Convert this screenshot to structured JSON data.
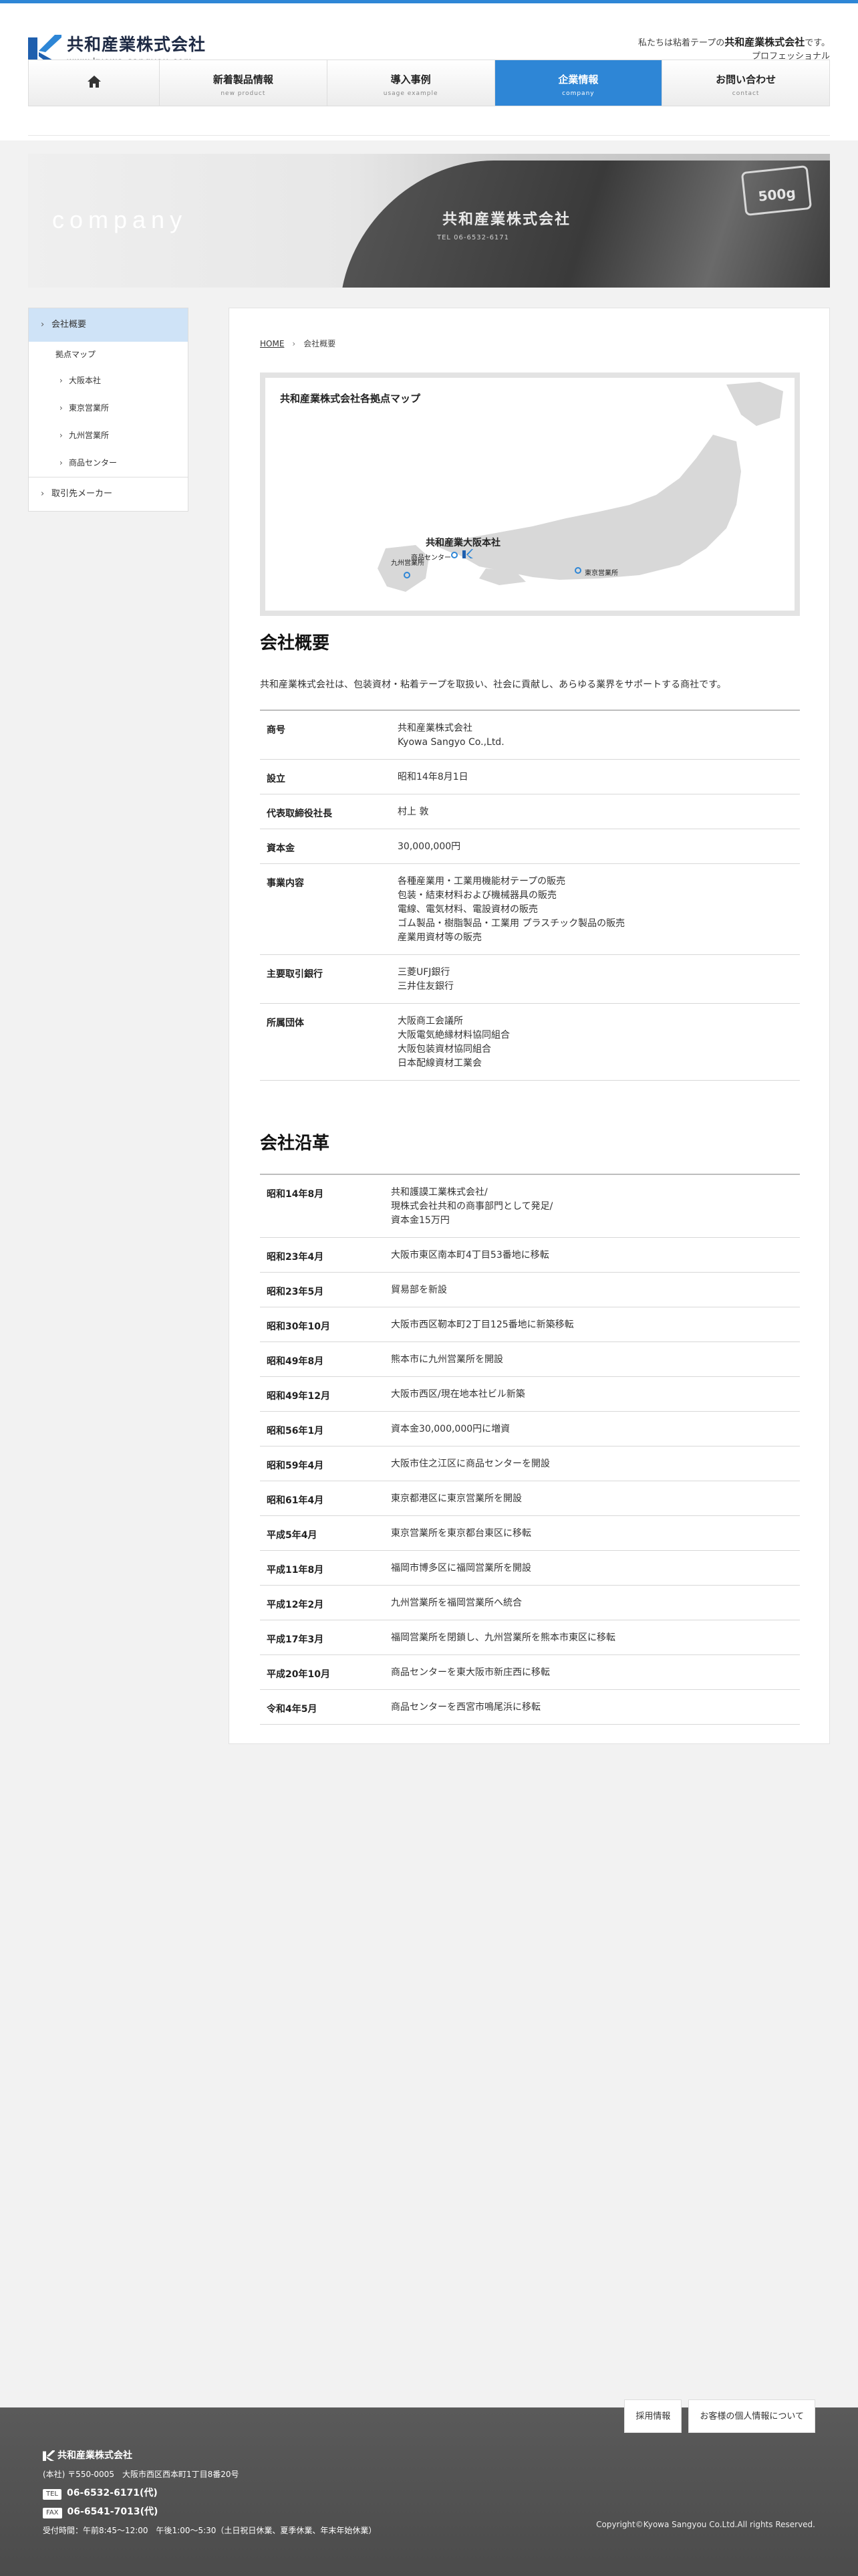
{
  "header": {
    "company_name": "共和産業株式会社",
    "url": "www.kyowa-sangyou.com",
    "tagline_prefix": "私たちは粘着テープの",
    "tagline_company": "共和産業株式会社",
    "tagline_suffix": "です。",
    "tagline_line2": "プロフェッショナル"
  },
  "nav": {
    "home_icon": "home-icon",
    "items": [
      {
        "label": "新着製品情報",
        "sub": "new product"
      },
      {
        "label": "導入事例",
        "sub": "usage example"
      },
      {
        "label": "企業情報",
        "sub": "company"
      },
      {
        "label": "お問い合わせ",
        "sub": "contact"
      }
    ]
  },
  "hero": {
    "word": "company",
    "tape_text": "共和産業株式会社",
    "tape_small": "TEL 06-6532-6171",
    "tape_badge": "500g"
  },
  "sidebar": {
    "item1": "会社概要",
    "sub_head": "拠点マップ",
    "subs": [
      "大阪本社",
      "東京営業所",
      "九州営業所",
      "商品センター"
    ],
    "item2": "取引先メーカー"
  },
  "breadcrumb": {
    "home": "HOME",
    "current": "会社概要"
  },
  "map": {
    "title": "共和産業株式会社各拠点マップ",
    "labels": {
      "osaka": "共和産業大阪本社",
      "center": "商品センター",
      "kyushu": "九州営業所",
      "tokyo": "東京営業所"
    }
  },
  "overview": {
    "heading": "会社概要",
    "intro": "共和産業株式会社は、包装資材・粘着テープを取扱い、社会に貢献し、あらゆる業界をサポートする商社です。",
    "rows": [
      {
        "label": "商号",
        "lines": [
          "共和産業株式会社",
          "Kyowa Sangyo Co.,Ltd."
        ]
      },
      {
        "label": "設立",
        "lines": [
          "昭和14年8月1日"
        ]
      },
      {
        "label": "代表取締役社長",
        "lines": [
          "村上 敦"
        ]
      },
      {
        "label": "資本金",
        "lines": [
          "30,000,000円"
        ]
      },
      {
        "label": "事業内容",
        "lines": [
          "各種産業用・工業用機能材テープの販売",
          "包装・結束材料および機械器具の販売",
          "電線、電気材料、電設資材の販売",
          "ゴム製品・樹脂製品・工業用 プラスチック製品の販売",
          "産業用資材等の販売"
        ]
      },
      {
        "label": "主要取引銀行",
        "lines": [
          "三菱UFJ銀行",
          "三井住友銀行"
        ]
      },
      {
        "label": "所属団体",
        "lines": [
          "大阪商工会議所",
          "大阪電気絶縁材料協同組合",
          "大阪包装資材協同組合",
          "日本配線資材工業会"
        ]
      }
    ]
  },
  "history": {
    "heading": "会社沿革",
    "rows": [
      {
        "label": "昭和14年8月",
        "lines": [
          "共和護謨工業株式会社/",
          "現株式会社共和の商事部門として発足/",
          "資本金15万円"
        ]
      },
      {
        "label": "昭和23年4月",
        "lines": [
          "大阪市東区南本町4丁目53番地に移転"
        ]
      },
      {
        "label": "昭和23年5月",
        "lines": [
          "貿易部を新設"
        ]
      },
      {
        "label": "昭和30年10月",
        "lines": [
          "大阪市西区靭本町2丁目125番地に新築移転"
        ]
      },
      {
        "label": "昭和49年8月",
        "lines": [
          "熊本市に九州営業所を開設"
        ]
      },
      {
        "label": "昭和49年12月",
        "lines": [
          "大阪市西区/現在地本社ビル新築"
        ]
      },
      {
        "label": "昭和56年1月",
        "lines": [
          "資本金30,000,000円に増資"
        ]
      },
      {
        "label": "昭和59年4月",
        "lines": [
          "大阪市住之江区に商品センターを開設"
        ]
      },
      {
        "label": "昭和61年4月",
        "lines": [
          "東京都港区に東京営業所を開設"
        ]
      },
      {
        "label": "平成5年4月",
        "lines": [
          "東京営業所を東京都台東区に移転"
        ]
      },
      {
        "label": "平成11年8月",
        "lines": [
          "福岡市博多区に福岡営業所を開設"
        ]
      },
      {
        "label": "平成12年2月",
        "lines": [
          "九州営業所を福岡営業所へ統合"
        ]
      },
      {
        "label": "平成17年3月",
        "lines": [
          "福岡営業所を閉鎖し、九州営業所を熊本市東区に移転"
        ]
      },
      {
        "label": "平成20年10月",
        "lines": [
          "商品センターを東大阪市新庄西に移転"
        ]
      },
      {
        "label": "令和4年5月",
        "lines": [
          "商品センターを西宮市鳴尾浜に移転"
        ]
      }
    ]
  },
  "footer": {
    "btn1": "採用情報",
    "btn2": "お客様の個人情報について",
    "company": "共和産業株式会社",
    "address": "(本社) 〒550-0005　大阪市西区西本町1丁目8番20号",
    "tel_tag": "TEL",
    "tel": "06-6532-6171(代)",
    "fax_tag": "FAX",
    "fax": "06-6541-7013(代)",
    "hours": "受付時間：午前8:45～12:00　午後1:00～5:30（土日祝日休業、夏季休業、年末年始休業）",
    "copyright": "Copyright©Kyowa Sangyou Co.Ltd.All rights Reserved."
  },
  "colors": {
    "accent": "#2e86d6",
    "logo_blue": "#1f5fae",
    "active_side": "#cfe3f7"
  }
}
